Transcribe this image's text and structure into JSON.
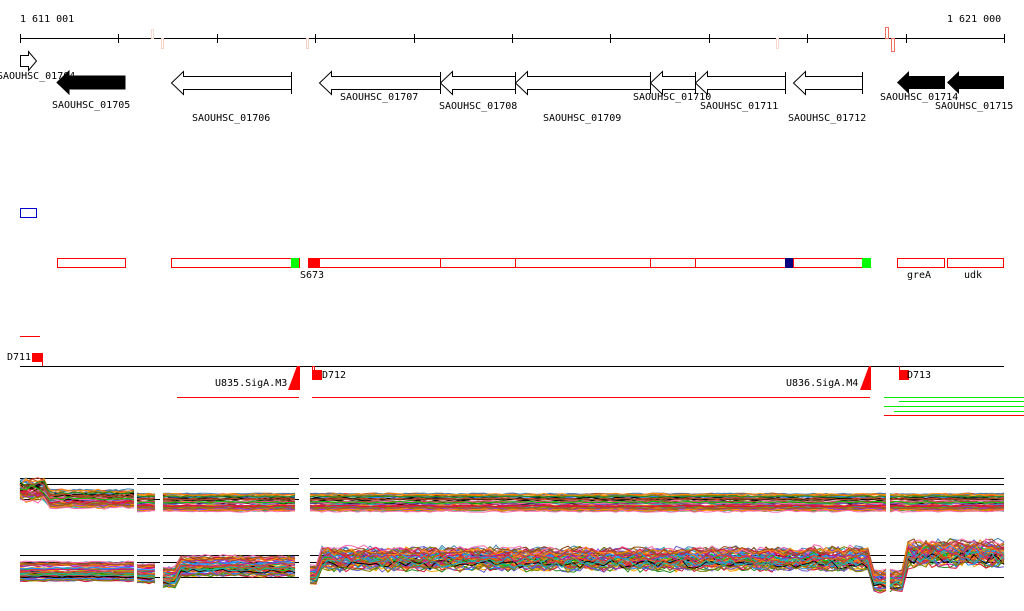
{
  "ruler": {
    "start_label": "1 611 001",
    "end_label": "1 621 000"
  },
  "genes": [
    {
      "name": "SAOUHSC_01704",
      "strand": "+",
      "filled": false
    },
    {
      "name": "SAOUHSC_01705",
      "strand": "-",
      "filled": true
    },
    {
      "name": "SAOUHSC_01706",
      "strand": "-",
      "filled": false
    },
    {
      "name": "SAOUHSC_01707",
      "strand": "-",
      "filled": false
    },
    {
      "name": "SAOUHSC_01708",
      "strand": "-",
      "filled": false
    },
    {
      "name": "SAOUHSC_01709",
      "strand": "-",
      "filled": false
    },
    {
      "name": "SAOUHSC_01710",
      "strand": "-",
      "filled": false
    },
    {
      "name": "SAOUHSC_01711",
      "strand": "-",
      "filled": false
    },
    {
      "name": "SAOUHSC_01712",
      "strand": "-",
      "filled": false
    },
    {
      "name": "SAOUHSC_01714",
      "strand": "-",
      "filled": true
    },
    {
      "name": "SAOUHSC_01715",
      "strand": "-",
      "filled": true
    }
  ],
  "features": {
    "s_label": "S673",
    "grea": "greA",
    "udk": "udk"
  },
  "regulatory": {
    "d711": "D711",
    "d712": "D712",
    "d713": "D713",
    "u835": "U835.SigA.M3",
    "u836": "U836.SigA.M4"
  },
  "colors": {
    "feature": "#ff0000",
    "green": "#00ff00",
    "navy": "#000080",
    "blue": "#0000cc",
    "marker": "#f07060"
  }
}
